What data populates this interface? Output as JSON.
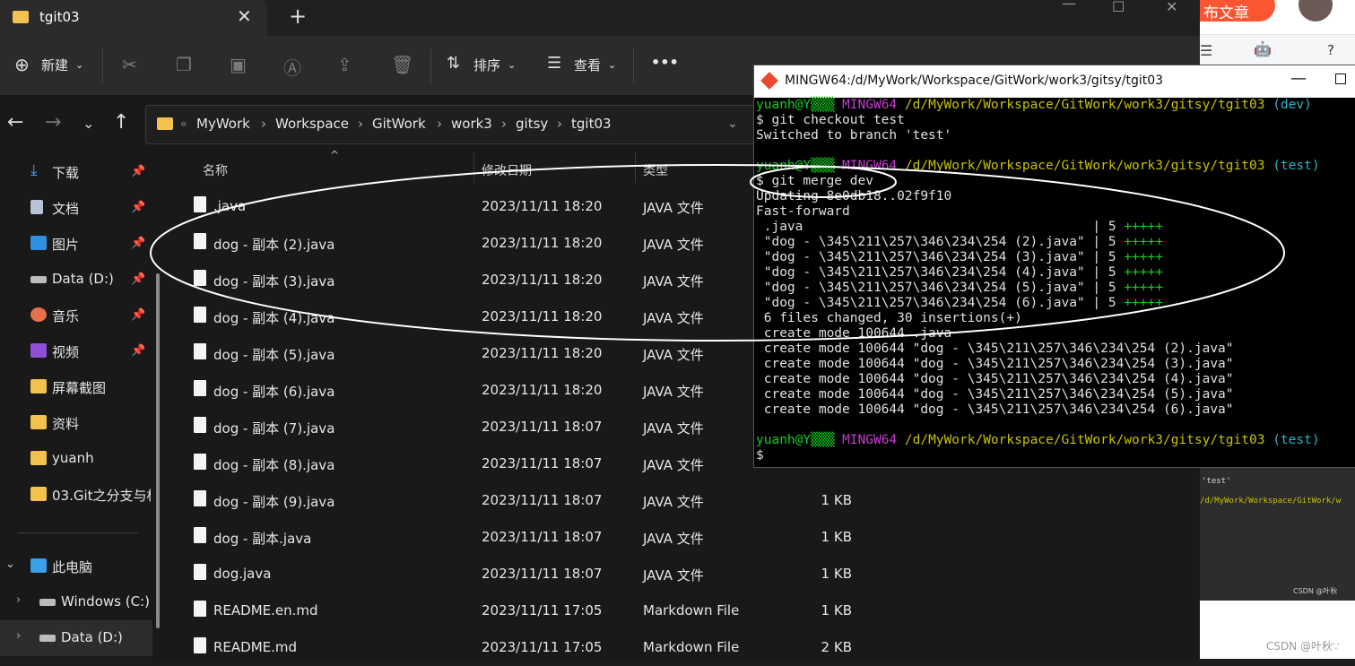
{
  "explorer": {
    "tab_title": "tgit03",
    "tab_close": "✕",
    "tab_new": "+",
    "window_controls": [
      "—",
      "☐",
      "✕"
    ],
    "toolbar": {
      "new_label": "新建",
      "sort_label": "排序",
      "view_label": "查看",
      "more_label": "•••"
    },
    "breadcrumb": [
      "MyWork",
      "Workspace",
      "GitWork",
      "work3",
      "gitsy",
      "tgit03"
    ],
    "columns": {
      "name": "名称",
      "modified": "修改日期",
      "type": "类型",
      "size": "大小"
    },
    "sidebar": {
      "quick": [
        {
          "label": "下载",
          "color": "#39a0ff"
        },
        {
          "label": "文档",
          "color": "#b8c4d6"
        },
        {
          "label": "图片",
          "color": "#2f8fe0"
        },
        {
          "label": "Data (D:)",
          "color": "#bbbbbb"
        },
        {
          "label": "音乐",
          "color": "#e8704a"
        },
        {
          "label": "视频",
          "color": "#8f4fd6"
        },
        {
          "label": "屏幕截图",
          "color": "#f2c14e"
        },
        {
          "label": "资料",
          "color": "#f2c14e"
        },
        {
          "label": "yuanh",
          "color": "#f2c14e"
        },
        {
          "label": "03.Git之分支与标签",
          "color": "#f2c14e"
        }
      ],
      "this_pc": "此电脑",
      "drives": [
        "Windows (C:)",
        "Data (D:)"
      ]
    },
    "files": [
      {
        "name": ".java",
        "date": "2023/11/11 18:20",
        "type": "JAVA 文件",
        "size": ""
      },
      {
        "name": "dog - 副本 (2).java",
        "date": "2023/11/11 18:20",
        "type": "JAVA 文件",
        "size": ""
      },
      {
        "name": "dog - 副本 (3).java",
        "date": "2023/11/11 18:20",
        "type": "JAVA 文件",
        "size": ""
      },
      {
        "name": "dog - 副本 (4).java",
        "date": "2023/11/11 18:20",
        "type": "JAVA 文件",
        "size": ""
      },
      {
        "name": "dog - 副本 (5).java",
        "date": "2023/11/11 18:20",
        "type": "JAVA 文件",
        "size": ""
      },
      {
        "name": "dog - 副本 (6).java",
        "date": "2023/11/11 18:20",
        "type": "JAVA 文件",
        "size": ""
      },
      {
        "name": "dog - 副本 (7).java",
        "date": "2023/11/11 18:07",
        "type": "JAVA 文件",
        "size": ""
      },
      {
        "name": "dog - 副本 (8).java",
        "date": "2023/11/11 18:07",
        "type": "JAVA 文件",
        "size": "1 KB"
      },
      {
        "name": "dog - 副本 (9).java",
        "date": "2023/11/11 18:07",
        "type": "JAVA 文件",
        "size": "1 KB"
      },
      {
        "name": "dog - 副本.java",
        "date": "2023/11/11 18:07",
        "type": "JAVA 文件",
        "size": "1 KB"
      },
      {
        "name": "dog.java",
        "date": "2023/11/11 18:07",
        "type": "JAVA 文件",
        "size": "1 KB"
      },
      {
        "name": "README.en.md",
        "date": "2023/11/11 17:05",
        "type": "Markdown File",
        "size": "1 KB"
      },
      {
        "name": "README.md",
        "date": "2023/11/11 17:05",
        "type": "Markdown File",
        "size": "2 KB"
      }
    ]
  },
  "browser": {
    "publish_label": "布文章",
    "dark_line1": "'test'",
    "dark_line2": "/d/MyWork/Workspace/GitWork/w",
    "csdn_small": "CSDN @叶秋",
    "watermark": "CSDN @叶秋∵"
  },
  "terminal": {
    "title": "MINGW64:/d/MyWork/Workspace/GitWork/work3/gitsy/tgit03",
    "prompt_user": "yuanh@",
    "prompt_env": "MINGW64",
    "prompt_path": "/d/MyWork/Workspace/GitWork/work3/gitsy/tgit03",
    "branch_dev": "(dev)",
    "branch_test": "(test)",
    "cmd1": "$ git checkout test",
    "out1": "Switched to branch 'test'",
    "cmd2": "$ git merge dev",
    "out_updating": "Updating 8e0db18..02f9f10",
    "out_ff": "Fast-forward",
    "stat_lines": [
      {
        "file": " .java                                     ",
        "count": "| 5 ",
        "plus": "+++++"
      },
      {
        "file": " \"dog - \\345\\211\\257\\346\\234\\254 (2).java\" ",
        "count": "| 5 ",
        "plus": "+++++"
      },
      {
        "file": " \"dog - \\345\\211\\257\\346\\234\\254 (3).java\" ",
        "count": "| 5 ",
        "plus": "+++++"
      },
      {
        "file": " \"dog - \\345\\211\\257\\346\\234\\254 (4).java\" ",
        "count": "| 5 ",
        "plus": "+++++"
      },
      {
        "file": " \"dog - \\345\\211\\257\\346\\234\\254 (5).java\" ",
        "count": "| 5 ",
        "plus": "+++++"
      },
      {
        "file": " \"dog - \\345\\211\\257\\346\\234\\254 (6).java\" ",
        "count": "| 5 ",
        "plus": "+++++"
      }
    ],
    "summary": " 6 files changed, 30 insertions(+)",
    "create_lines": [
      " create mode 100644 .java",
      " create mode 100644 \"dog - \\345\\211\\257\\346\\234\\254 (2).java\"",
      " create mode 100644 \"dog - \\345\\211\\257\\346\\234\\254 (3).java\"",
      " create mode 100644 \"dog - \\345\\211\\257\\346\\234\\254 (4).java\"",
      " create mode 100644 \"dog - \\345\\211\\257\\346\\234\\254 (5).java\"",
      " create mode 100644 \"dog - \\345\\211\\257\\346\\234\\254 (6).java\""
    ],
    "final_prompt": "$"
  }
}
